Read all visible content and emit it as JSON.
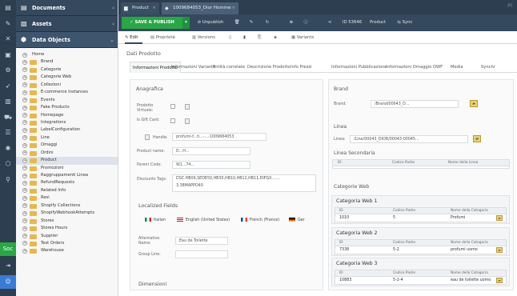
{
  "sidebar": {
    "documents": "Documents",
    "assets": "Assets",
    "data_objects": "Data Objects"
  },
  "tree": [
    {
      "label": "Home",
      "root": true
    },
    {
      "label": "Brand"
    },
    {
      "label": "Categorie"
    },
    {
      "label": "Categorie Web"
    },
    {
      "label": "Collezioni"
    },
    {
      "label": "E-commerce Instances"
    },
    {
      "label": "Events"
    },
    {
      "label": "Fake Products"
    },
    {
      "label": "Homepage"
    },
    {
      "label": "Integrations"
    },
    {
      "label": "LabelConfiguration"
    },
    {
      "label": "Line"
    },
    {
      "label": "Omaggi"
    },
    {
      "label": "Ordini"
    },
    {
      "label": "Product",
      "selected": true
    },
    {
      "label": "Promozioni"
    },
    {
      "label": "Raggruppamenti Linea"
    },
    {
      "label": "RefundRequests"
    },
    {
      "label": "Related Info"
    },
    {
      "label": "Resi"
    },
    {
      "label": "Shopify Collections"
    },
    {
      "label": "ShopifyWebhookAttempts"
    },
    {
      "label": "Stores"
    },
    {
      "label": "Stores Hours"
    },
    {
      "label": "Supplier"
    },
    {
      "label": "Test Orders"
    },
    {
      "label": "Warehouse"
    }
  ],
  "tabs": {
    "tab1": "Product",
    "tab2": "1009684053_Dior Homme",
    "brand": "PI"
  },
  "toolbar": {
    "save": "SAVE & PUBLISH",
    "unpublish": "Unpublish",
    "id": "ID 53646",
    "type": "Product",
    "sync": "Sync"
  },
  "subtabs": {
    "edit": "Edit",
    "properties": "Proprietà",
    "versions": "Versions",
    "variants": "Variants"
  },
  "content": {
    "title": "Dati Prodotto",
    "tabs": [
      "Informazioni Prodotto",
      "Informazioni Variante",
      "Entità correlate",
      "Descrizione Prodotto",
      "Info Prezzi",
      "Informazioni Pubblicazione",
      "Informazioni Omaggio OWF",
      "Media",
      "Synchr"
    ],
    "anagrafica": {
      "title": "Anagrafica",
      "virtual_label": "Prodotto Virtuale:",
      "giftcard_label": "Is Gift Card:",
      "handle_label": "Handle:",
      "handle_value": "profumi-f...h...-...-1009684053",
      "name_label": "Product name:",
      "name_value": "D...H...",
      "parent_label": "Parent Code:",
      "parent_value": "W1...74...",
      "discount_label": "Discounts Tags:",
      "discount_value": "DSC.HB06,SEDE50,HB30,HB10,HB12,HB11,DIFG0.......",
      "discount_value2": "3.38MAPPO40"
    },
    "localized": {
      "title": "Localized Fields",
      "langs": [
        "Italian",
        "English (United States)",
        "French (France)",
        "Ger"
      ],
      "alt_label": "Alternative Name:",
      "alt_value": "Eau de Toilette",
      "group_label": "Group Line:"
    },
    "dimensioni": "Dimensioni",
    "brand": {
      "title": "Brand",
      "label": "Brand:",
      "value": "/Brand/00043_D..."
    },
    "linea": {
      "title": "Linea",
      "label": "Linea:",
      "value": "/Line/00043_DIOR/00043-00045...",
      "secondaria": "Linea Secondaria",
      "cols": [
        "ID",
        "Codice Padre",
        "Nome della Linea"
      ]
    },
    "catweb": {
      "title": "Categorie Web",
      "cols": [
        "ID",
        "Codice Padre",
        "Nome della Categoria"
      ],
      "items": [
        {
          "title": "Categoria Web 1",
          "id": "1010",
          "code": "5",
          "name": "Profumi"
        },
        {
          "title": "Categoria Web 2",
          "id": "7338",
          "code": "5-2",
          "name": "profumi uomo"
        },
        {
          "title": "Categoria Web 3",
          "id": "10883",
          "code": "5-2-4",
          "name": "eau de toilette uomo"
        }
      ]
    }
  },
  "rail": {
    "bottom1": "Soc"
  }
}
